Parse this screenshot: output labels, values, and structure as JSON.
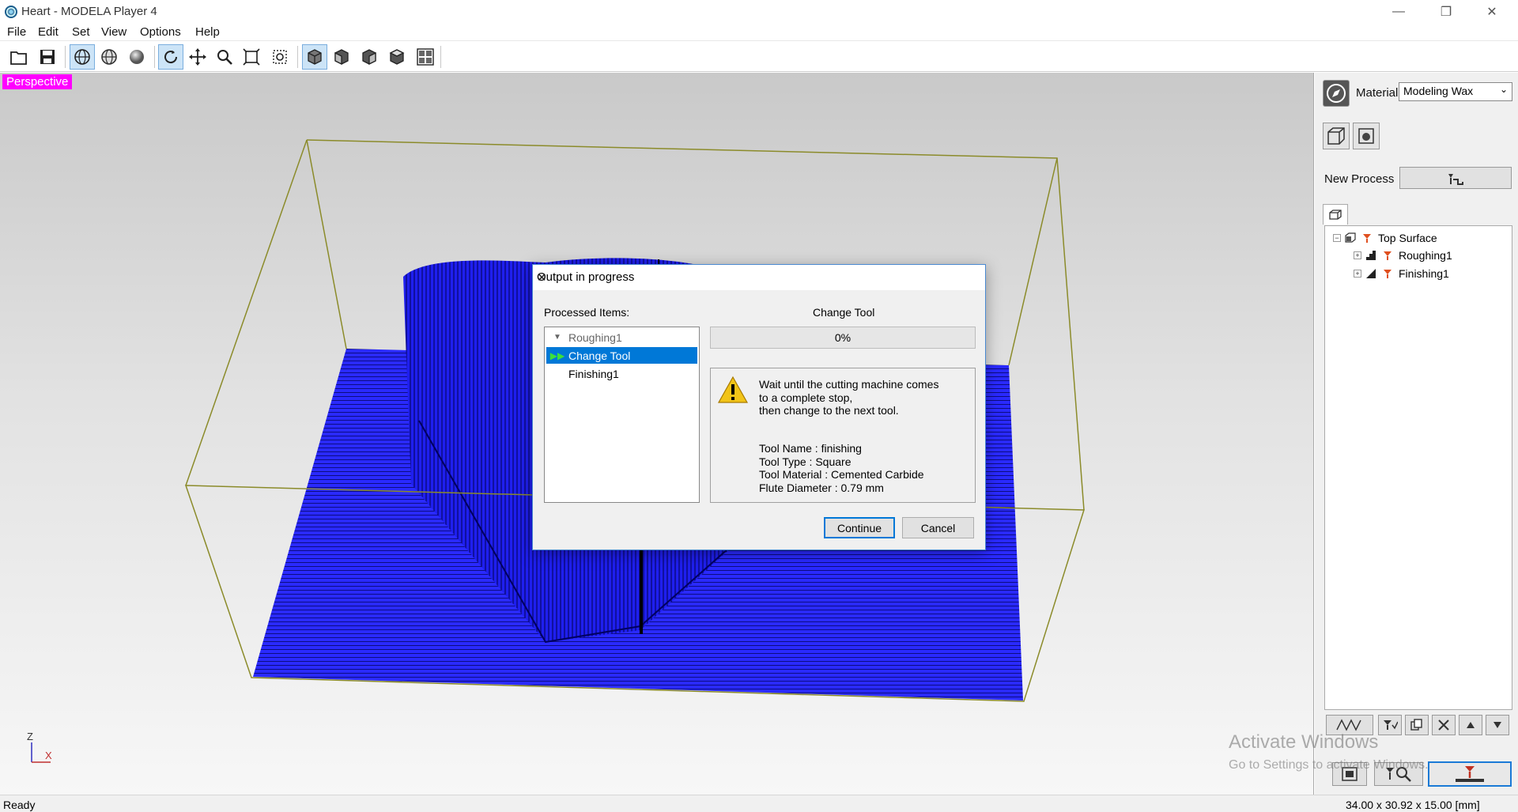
{
  "window": {
    "title": "Heart - MODELA Player 4"
  },
  "menu": [
    "File",
    "Edit",
    "Set",
    "View",
    "Options",
    "Help"
  ],
  "viewport": {
    "view_label": "Perspective",
    "axis_z": "Z",
    "axis_x": "X"
  },
  "panel": {
    "material_label": "Material",
    "material_value": "Modeling Wax",
    "new_process_label": "New Process",
    "tree": {
      "root": "Top Surface",
      "children": [
        "Roughing1",
        "Finishing1"
      ]
    }
  },
  "dialog": {
    "title": "Output in progress",
    "processed_label": "Processed Items:",
    "items": [
      "Roughing1",
      "Change Tool",
      "Finishing1"
    ],
    "status_heading": "Change Tool",
    "progress_text": "0%",
    "progress_fraction": 0,
    "message": {
      "line1": "Wait until the cutting machine comes",
      "line2": "to a complete stop,",
      "line3": "then change to the next tool.",
      "tool_name": "Tool Name : finishing",
      "tool_type": "Tool Type : Square",
      "tool_material": "Tool Material : Cemented Carbide",
      "flute_diameter": "Flute Diameter : 0.79 mm"
    },
    "continue_label": "Continue",
    "cancel_label": "Cancel"
  },
  "status": {
    "left": "Ready",
    "right": "34.00 x 30.92 x 15.00 [mm]"
  },
  "watermark": {
    "line1": "Activate Windows",
    "line2": "Go to Settings to activate Windows."
  },
  "colors": {
    "mesh": "#1a1aff",
    "bounding_box": "#8b8b2a",
    "selection": "#0078d7",
    "view_label_bg": "#ff00ff"
  }
}
